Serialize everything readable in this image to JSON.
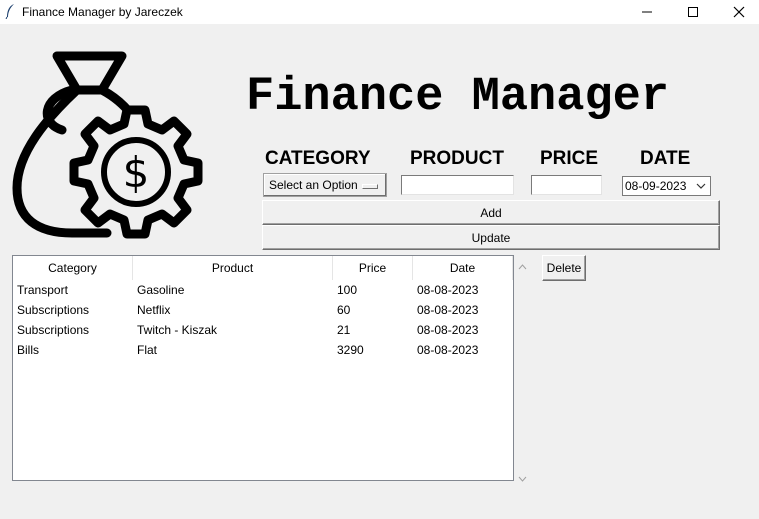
{
  "window": {
    "title": "Finance Manager by Jareczek",
    "controls": {
      "minimize": "—",
      "maximize": "☐",
      "close": "✕"
    }
  },
  "header": {
    "title": "Finance Manager",
    "logo_icon": "money-bag-gear-icon"
  },
  "form": {
    "category_label": "CATEGORY",
    "product_label": "PRODUCT",
    "price_label": "PRICE",
    "date_label": "DATE",
    "category_value": "Select an Option",
    "product_value": "",
    "price_value": "",
    "date_value": "08-09-2023"
  },
  "buttons": {
    "add": "Add",
    "update": "Update",
    "delete": "Delete"
  },
  "table": {
    "columns": [
      "Category",
      "Product",
      "Price",
      "Date"
    ],
    "rows": [
      [
        "Transport",
        "Gasoline",
        "100",
        "08-08-2023"
      ],
      [
        "Subscriptions",
        "Netflix",
        "60",
        "08-08-2023"
      ],
      [
        "Subscriptions",
        "Twitch - Kiszak",
        "21",
        "08-08-2023"
      ],
      [
        "Bills",
        "Flat",
        "3290",
        "08-08-2023"
      ]
    ]
  },
  "colors": {
    "background": "#f0f0f0",
    "titlebar": "#ffffff",
    "text": "#000000"
  }
}
